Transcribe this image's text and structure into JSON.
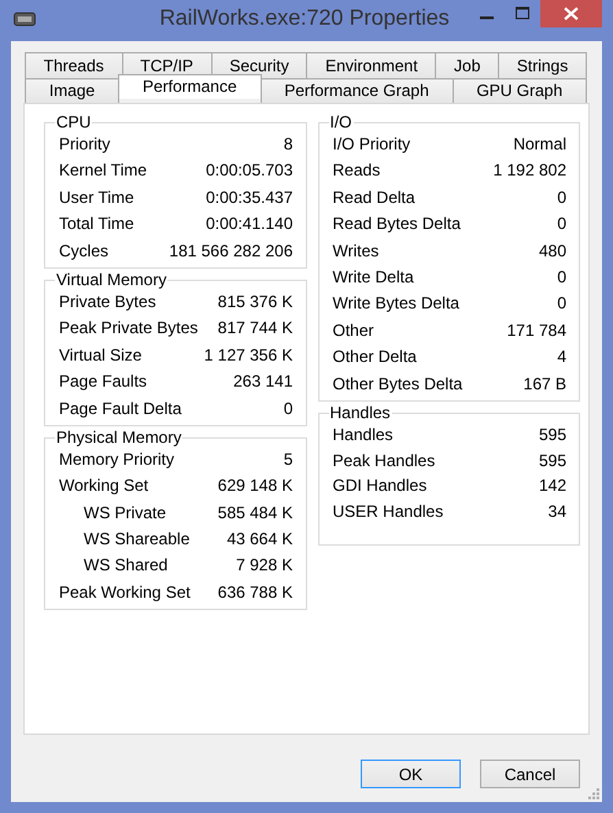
{
  "window": {
    "title": "RailWorks.exe:720 Properties"
  },
  "tab_rows": [
    [
      {
        "label": "Threads",
        "selected": false
      },
      {
        "label": "TCP/IP",
        "selected": false
      },
      {
        "label": "Security",
        "selected": false
      },
      {
        "label": "Environment",
        "selected": false
      },
      {
        "label": "Job",
        "selected": false
      },
      {
        "label": "Strings",
        "selected": false
      }
    ],
    [
      {
        "label": "Image",
        "selected": false
      },
      {
        "label": "Performance",
        "selected": true
      },
      {
        "label": "Performance Graph",
        "selected": false
      },
      {
        "label": "GPU Graph",
        "selected": false
      }
    ]
  ],
  "columns": [
    [
      {
        "title": "CPU",
        "rows": [
          {
            "label": "Priority",
            "value": "8"
          },
          {
            "label": "Kernel Time",
            "value": "0:00:05.703"
          },
          {
            "label": "User Time",
            "value": "0:00:35.437"
          },
          {
            "label": "Total Time",
            "value": "0:00:41.140"
          },
          {
            "label": "Cycles",
            "value": "181 566 282 206"
          }
        ]
      },
      {
        "title": "Virtual Memory",
        "rows": [
          {
            "label": "Private Bytes",
            "value": "815 376 K"
          },
          {
            "label": "Peak Private Bytes",
            "value": "817 744 K"
          },
          {
            "label": "Virtual Size",
            "value": "1 127 356 K"
          },
          {
            "label": "Page Faults",
            "value": "263 141"
          },
          {
            "label": "Page Fault Delta",
            "value": "0"
          }
        ]
      },
      {
        "title": "Physical Memory",
        "rows": [
          {
            "label": "Memory Priority",
            "value": "5"
          },
          {
            "label": "Working Set",
            "value": "629 148 K",
            "children": [
              {
                "label": "WS Private",
                "value": "585 484 K"
              },
              {
                "label": "WS Shareable",
                "value": "43 664 K"
              },
              {
                "label": "WS Shared",
                "value": "7 928 K"
              }
            ]
          },
          {
            "label": "Peak Working Set",
            "value": "636 788 K"
          }
        ]
      }
    ],
    [
      {
        "title": "I/O",
        "rows": [
          {
            "label": "I/O Priority",
            "value": "Normal"
          },
          {
            "label": "Reads",
            "value": "1 192 802"
          },
          {
            "label": "Read Delta",
            "value": "0"
          },
          {
            "label": "Read Bytes Delta",
            "value": "0"
          },
          {
            "label": "Writes",
            "value": "480"
          },
          {
            "label": "Write Delta",
            "value": "0"
          },
          {
            "label": "Write Bytes Delta",
            "value": "0"
          },
          {
            "label": "Other",
            "value": "171 784"
          },
          {
            "label": "Other Delta",
            "value": "4"
          },
          {
            "label": "Other Bytes Delta",
            "value": "167 B"
          }
        ]
      },
      {
        "title": "Handles",
        "rows": [
          {
            "label": "Handles",
            "value": "595"
          },
          {
            "label": "Peak Handles",
            "value": "595"
          },
          {
            "label": "GDI Handles",
            "value": "142"
          },
          {
            "label": "USER Handles",
            "value": "34"
          }
        ]
      }
    ]
  ],
  "buttons": [
    {
      "label": "OK",
      "default": true
    },
    {
      "label": "Cancel",
      "default": false
    }
  ]
}
